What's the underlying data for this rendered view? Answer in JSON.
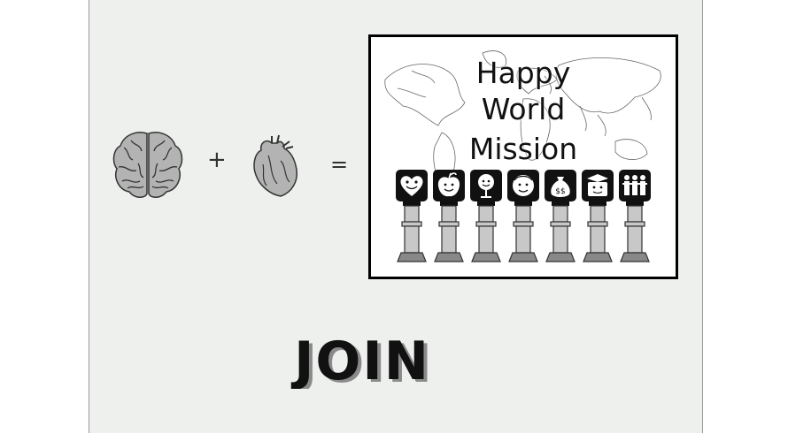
{
  "equation": {
    "operand1_icon": "brain-icon",
    "plus_sign": "+",
    "operand2_icon": "heart-icon",
    "equals_sign": "="
  },
  "poster": {
    "title_line1": "Happy",
    "title_line2": "World",
    "title_line3": "Mission",
    "background_icon": "world-map",
    "pillar_icons": [
      "smiling-heart-icon",
      "apple-icon",
      "microphone-face-icon",
      "face-icon",
      "money-bag-icon",
      "graduate-face-icon",
      "people-group-icon"
    ]
  },
  "join_label": "JOIN",
  "colors": {
    "stage_background": "#eef0ee",
    "poster_border": "#000000",
    "organ_fill": "#b3b3b3",
    "pillar_fill": "#c8c8c8"
  }
}
